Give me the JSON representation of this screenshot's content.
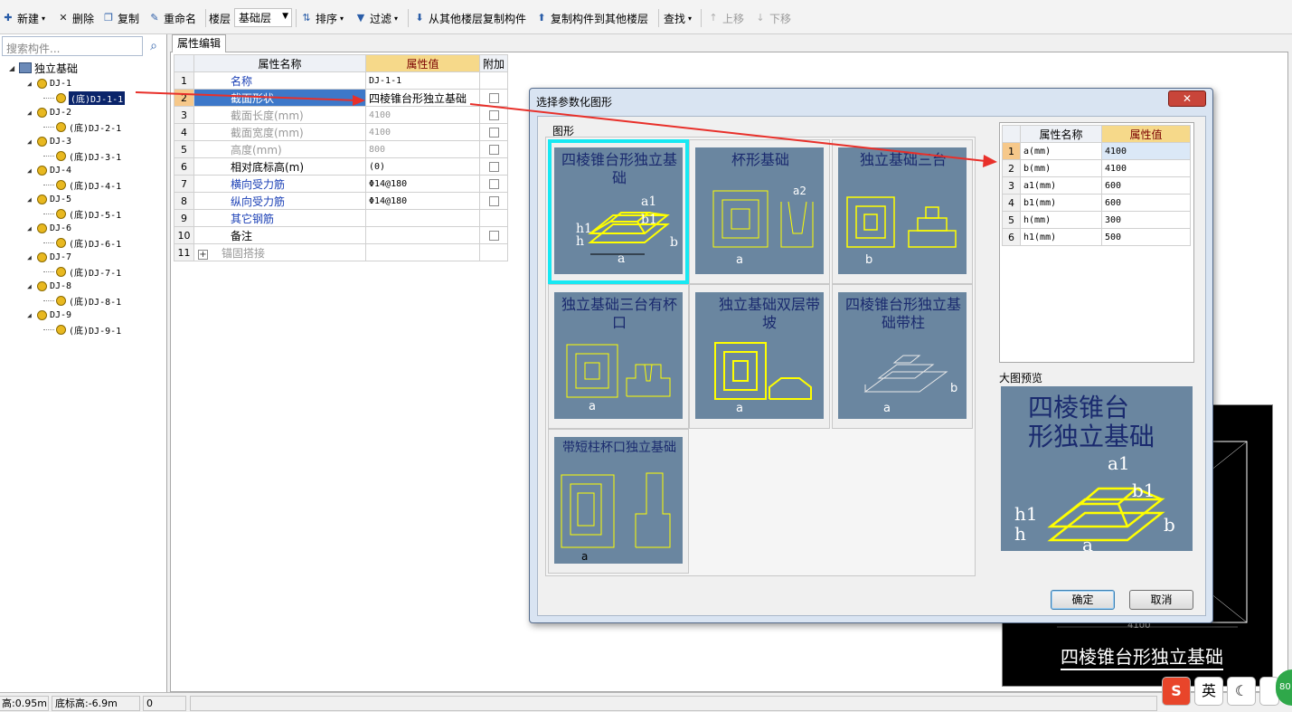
{
  "toolbar": {
    "new_label": "新建",
    "delete_label": "删除",
    "copy_label": "复制",
    "rename_label": "重命名",
    "floor_label": "楼层",
    "floor_value": "基础层",
    "sort_label": "排序",
    "filter_label": "过滤",
    "copy_from_floor_label": "从其他楼层复制构件",
    "copy_to_floor_label": "复制构件到其他楼层",
    "find_label": "查找",
    "move_up_label": "上移",
    "move_down_label": "下移"
  },
  "left_panel": {
    "search_placeholder": "搜索构件...",
    "root_label": "独立基础",
    "groups": [
      {
        "label": "DJ-1",
        "child": "(底)DJ-1-1"
      },
      {
        "label": "DJ-2",
        "child": "(底)DJ-2-1"
      },
      {
        "label": "DJ-3",
        "child": "(底)DJ-3-1"
      },
      {
        "label": "DJ-4",
        "child": "(底)DJ-4-1"
      },
      {
        "label": "DJ-5",
        "child": "(底)DJ-5-1"
      },
      {
        "label": "DJ-6",
        "child": "(底)DJ-6-1"
      },
      {
        "label": "DJ-7",
        "child": "(底)DJ-7-1"
      },
      {
        "label": "DJ-8",
        "child": "(底)DJ-8-1"
      },
      {
        "label": "DJ-9",
        "child": "(底)DJ-9-1"
      }
    ],
    "selected_child": "(底)DJ-1-1"
  },
  "tab": {
    "label": "属性编辑"
  },
  "property_grid": {
    "headers": {
      "name": "属性名称",
      "value": "属性值",
      "extra": "附加"
    },
    "rows": [
      {
        "num": "1",
        "name": "名称",
        "value": "DJ-1-1"
      },
      {
        "num": "2",
        "name": "截面形状",
        "value": "四棱锥台形独立基础"
      },
      {
        "num": "3",
        "name": "截面长度(mm)",
        "value": "4100"
      },
      {
        "num": "4",
        "name": "截面宽度(mm)",
        "value": "4100"
      },
      {
        "num": "5",
        "name": "高度(mm)",
        "value": "800"
      },
      {
        "num": "6",
        "name": "相对底标高(m)",
        "value": "(0)"
      },
      {
        "num": "7",
        "name": "横向受力筋",
        "value": "Φ14@180"
      },
      {
        "num": "8",
        "name": "纵向受力筋",
        "value": "Φ14@180"
      },
      {
        "num": "9",
        "name": "其它钢筋",
        "value": ""
      },
      {
        "num": "10",
        "name": "备注",
        "value": ""
      },
      {
        "num": "11",
        "name": "锚固搭接",
        "value": ""
      }
    ]
  },
  "dialog": {
    "title": "选择参数化图形",
    "shapes_label": "图形",
    "shapes": [
      {
        "title": "四棱锥台形独立基础"
      },
      {
        "title": "杯形基础"
      },
      {
        "title": "独立基础三台"
      },
      {
        "title": "独立基础三台有杯口"
      },
      {
        "title": "独立基础双层带坡"
      },
      {
        "title": "四棱锥台形独立基础带柱"
      },
      {
        "title": "带短柱杯口独立基础"
      }
    ],
    "param_headers": {
      "name": "属性名称",
      "value": "属性值"
    },
    "params": [
      {
        "num": "1",
        "name": "a(mm)",
        "value": "4100"
      },
      {
        "num": "2",
        "name": "b(mm)",
        "value": "4100"
      },
      {
        "num": "3",
        "name": "a1(mm)",
        "value": "600"
      },
      {
        "num": "4",
        "name": "b1(mm)",
        "value": "600"
      },
      {
        "num": "5",
        "name": "h(mm)",
        "value": "300"
      },
      {
        "num": "6",
        "name": "h1(mm)",
        "value": "500"
      }
    ],
    "preview_label": "大图预览",
    "preview_title_line1": "四棱锥台",
    "preview_title_line2": "形独立基础",
    "ok_label": "确定",
    "cancel_label": "取消"
  },
  "canvas": {
    "title": "四棱锥台形独立基础",
    "dim": "4100"
  },
  "status": {
    "height": "高:0.95m",
    "base_elev": "底标高:-6.9m",
    "field3": "0"
  },
  "tray": {
    "sogou": "S",
    "lang": "英",
    "moon": "☾",
    "badge": "80"
  }
}
